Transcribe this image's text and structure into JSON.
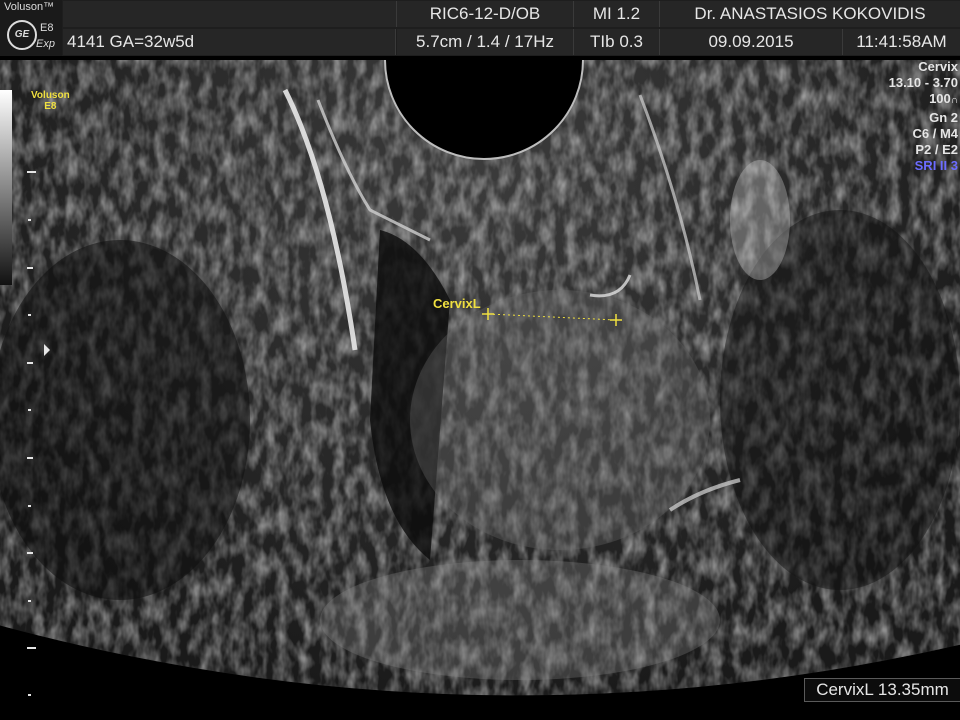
{
  "header": {
    "brand": "Voluson™",
    "logo": "GE",
    "model": "E8",
    "mode": "Exp",
    "probe": "RIC6-12-D/OB",
    "mi": "MI  1.2",
    "operator": "Dr. ANASTASIOS KOKOVIDIS",
    "patient": "4141  GA=32w5d",
    "depth_settings": "5.7cm / 1.4 / 17Hz",
    "tib": "TIb  0.3",
    "date": "09.09.2015",
    "time": "11:41:58AM"
  },
  "side_label": {
    "line1": "Voluson",
    "line2": "E8"
  },
  "params": {
    "preset": "Cervix",
    "freq": "13.10 - 3.70",
    "power": "100",
    "gain": "Gn  2",
    "cm": "C6 / M4",
    "pe": "P2 / E2",
    "sri": "SRI II 3"
  },
  "measurement": {
    "label": "CervixL",
    "result": "CervixL 13.35mm",
    "value_mm": 13.35
  },
  "colors": {
    "caliper": "#f0e040",
    "sri": "#6c6cff"
  }
}
